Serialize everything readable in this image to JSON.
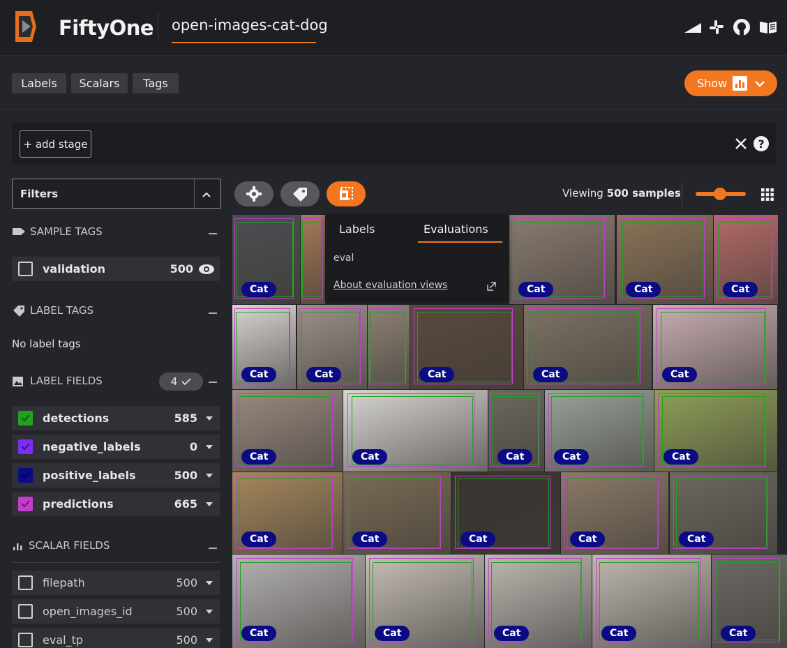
{
  "header": {
    "brand": "FiftyOne",
    "dataset": "open-images-cat-dog",
    "icons": [
      "signal-icon",
      "slack-icon",
      "github-icon",
      "book-icon"
    ]
  },
  "tabs": [
    "Labels",
    "Scalars",
    "Tags"
  ],
  "show_button": {
    "label": "Show",
    "icons": [
      "chart-icon",
      "chevron-down-icon"
    ]
  },
  "view_bar": {
    "add_stage_label": "+ add stage",
    "icons": [
      "close-icon",
      "help-icon"
    ]
  },
  "sidebar": {
    "filters_label": "Filters",
    "sample_tags": {
      "title": "SAMPLE TAGS",
      "items": [
        {
          "label": "validation",
          "count": "500"
        }
      ]
    },
    "label_tags": {
      "title": "LABEL TAGS",
      "empty_text": "No label tags"
    },
    "label_fields": {
      "title": "LABEL FIELDS",
      "badge": "4",
      "items": [
        {
          "label": "detections",
          "count": "585",
          "color": "#1fa31f"
        },
        {
          "label": "negative_labels",
          "count": "0",
          "color": "#7b2ff0"
        },
        {
          "label": "positive_labels",
          "count": "500",
          "color": "#0b0b86"
        },
        {
          "label": "predictions",
          "count": "665",
          "color": "#c23dcc"
        }
      ]
    },
    "scalar_fields": {
      "title": "SCALAR FIELDS",
      "items": [
        {
          "label": "filepath",
          "count": "500"
        },
        {
          "label": "open_images_id",
          "count": "500"
        },
        {
          "label": "eval_tp",
          "count": "500"
        }
      ]
    }
  },
  "grid_toolbar": {
    "viewing_prefix": "Viewing ",
    "viewing_count": "500 samples",
    "icons": [
      "settings-icon",
      "tag-icon",
      "evaluation-icon",
      "grid-icon"
    ]
  },
  "popover": {
    "tabs": [
      "Labels",
      "Evaluations"
    ],
    "active_tab": "Evaluations",
    "item": "eval",
    "link": "About evaluation views"
  },
  "grid": {
    "label": "Cat"
  },
  "colors": {
    "accent": "#f37721",
    "positive": "#0b0b86",
    "detections": "#1fa31f",
    "predictions": "#c23dcc"
  }
}
